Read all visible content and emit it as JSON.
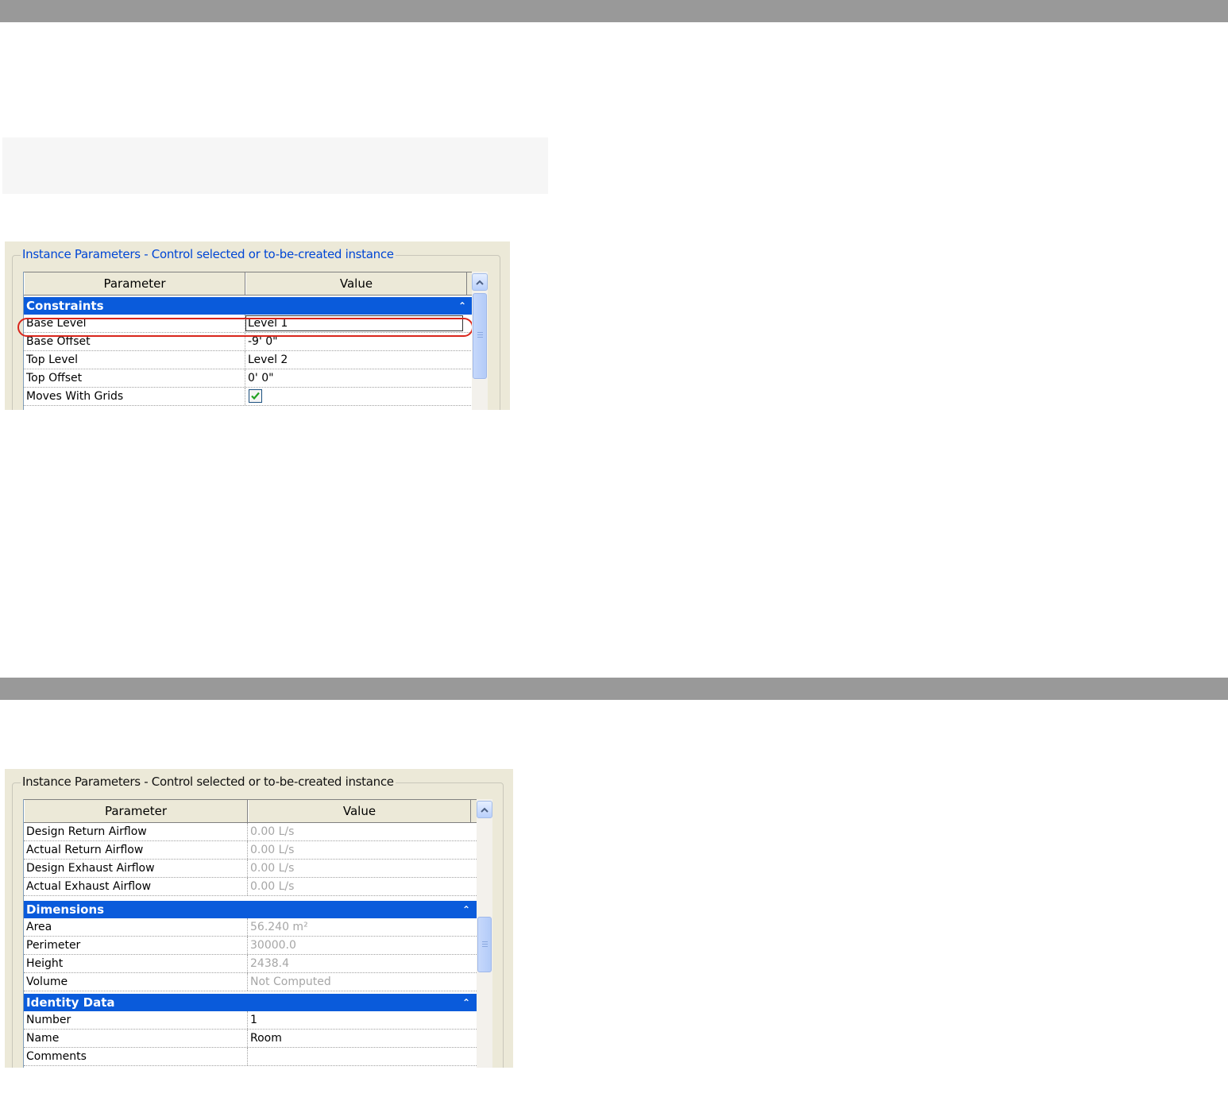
{
  "dialog1": {
    "legend": "Instance Parameters - Control selected or to-be-created instance",
    "header": {
      "parameter": "Parameter",
      "value": "Value"
    },
    "section": "Constraints",
    "rows": [
      {
        "param": "Base Level",
        "value": "Level 1"
      },
      {
        "param": "Base Offset",
        "value": "-9'  0\""
      },
      {
        "param": "Top Level",
        "value": "Level 2"
      },
      {
        "param": "Top Offset",
        "value": "0'  0\""
      },
      {
        "param": "Moves With Grids",
        "checked": true
      }
    ]
  },
  "dialog2": {
    "legend": "Instance Parameters - Control selected or to-be-created instance",
    "header": {
      "parameter": "Parameter",
      "value": "Value"
    },
    "airflow_rows": [
      {
        "param": "Design Return Airflow",
        "value": "0.00 L/s"
      },
      {
        "param": "Actual Return Airflow",
        "value": "0.00 L/s"
      },
      {
        "param": "Design Exhaust Airflow",
        "value": "0.00 L/s"
      },
      {
        "param": "Actual Exhaust Airflow",
        "value": "0.00 L/s"
      }
    ],
    "dimensions": {
      "title": "Dimensions",
      "rows": [
        {
          "param": "Area",
          "value": "56.240 m²"
        },
        {
          "param": "Perimeter",
          "value": "30000.0"
        },
        {
          "param": "Height",
          "value": "2438.4"
        },
        {
          "param": "Volume",
          "value": "Not Computed"
        }
      ]
    },
    "identity": {
      "title": "Identity Data",
      "rows": [
        {
          "param": "Number",
          "value": "1"
        },
        {
          "param": "Name",
          "value": "Room"
        },
        {
          "param": "Comments",
          "value": ""
        }
      ]
    }
  },
  "icons": {
    "collapse": "double-chevron-up-icon",
    "scroll_up": "scroll-up-arrow-icon",
    "check": "checkmark-icon"
  },
  "colors": {
    "section_header": "#0a5bdb",
    "dialog_bg": "#ece9d8",
    "highlight_ring": "#d9261c",
    "readonly_text": "#a6a6a6",
    "separator_bar": "#999999"
  }
}
